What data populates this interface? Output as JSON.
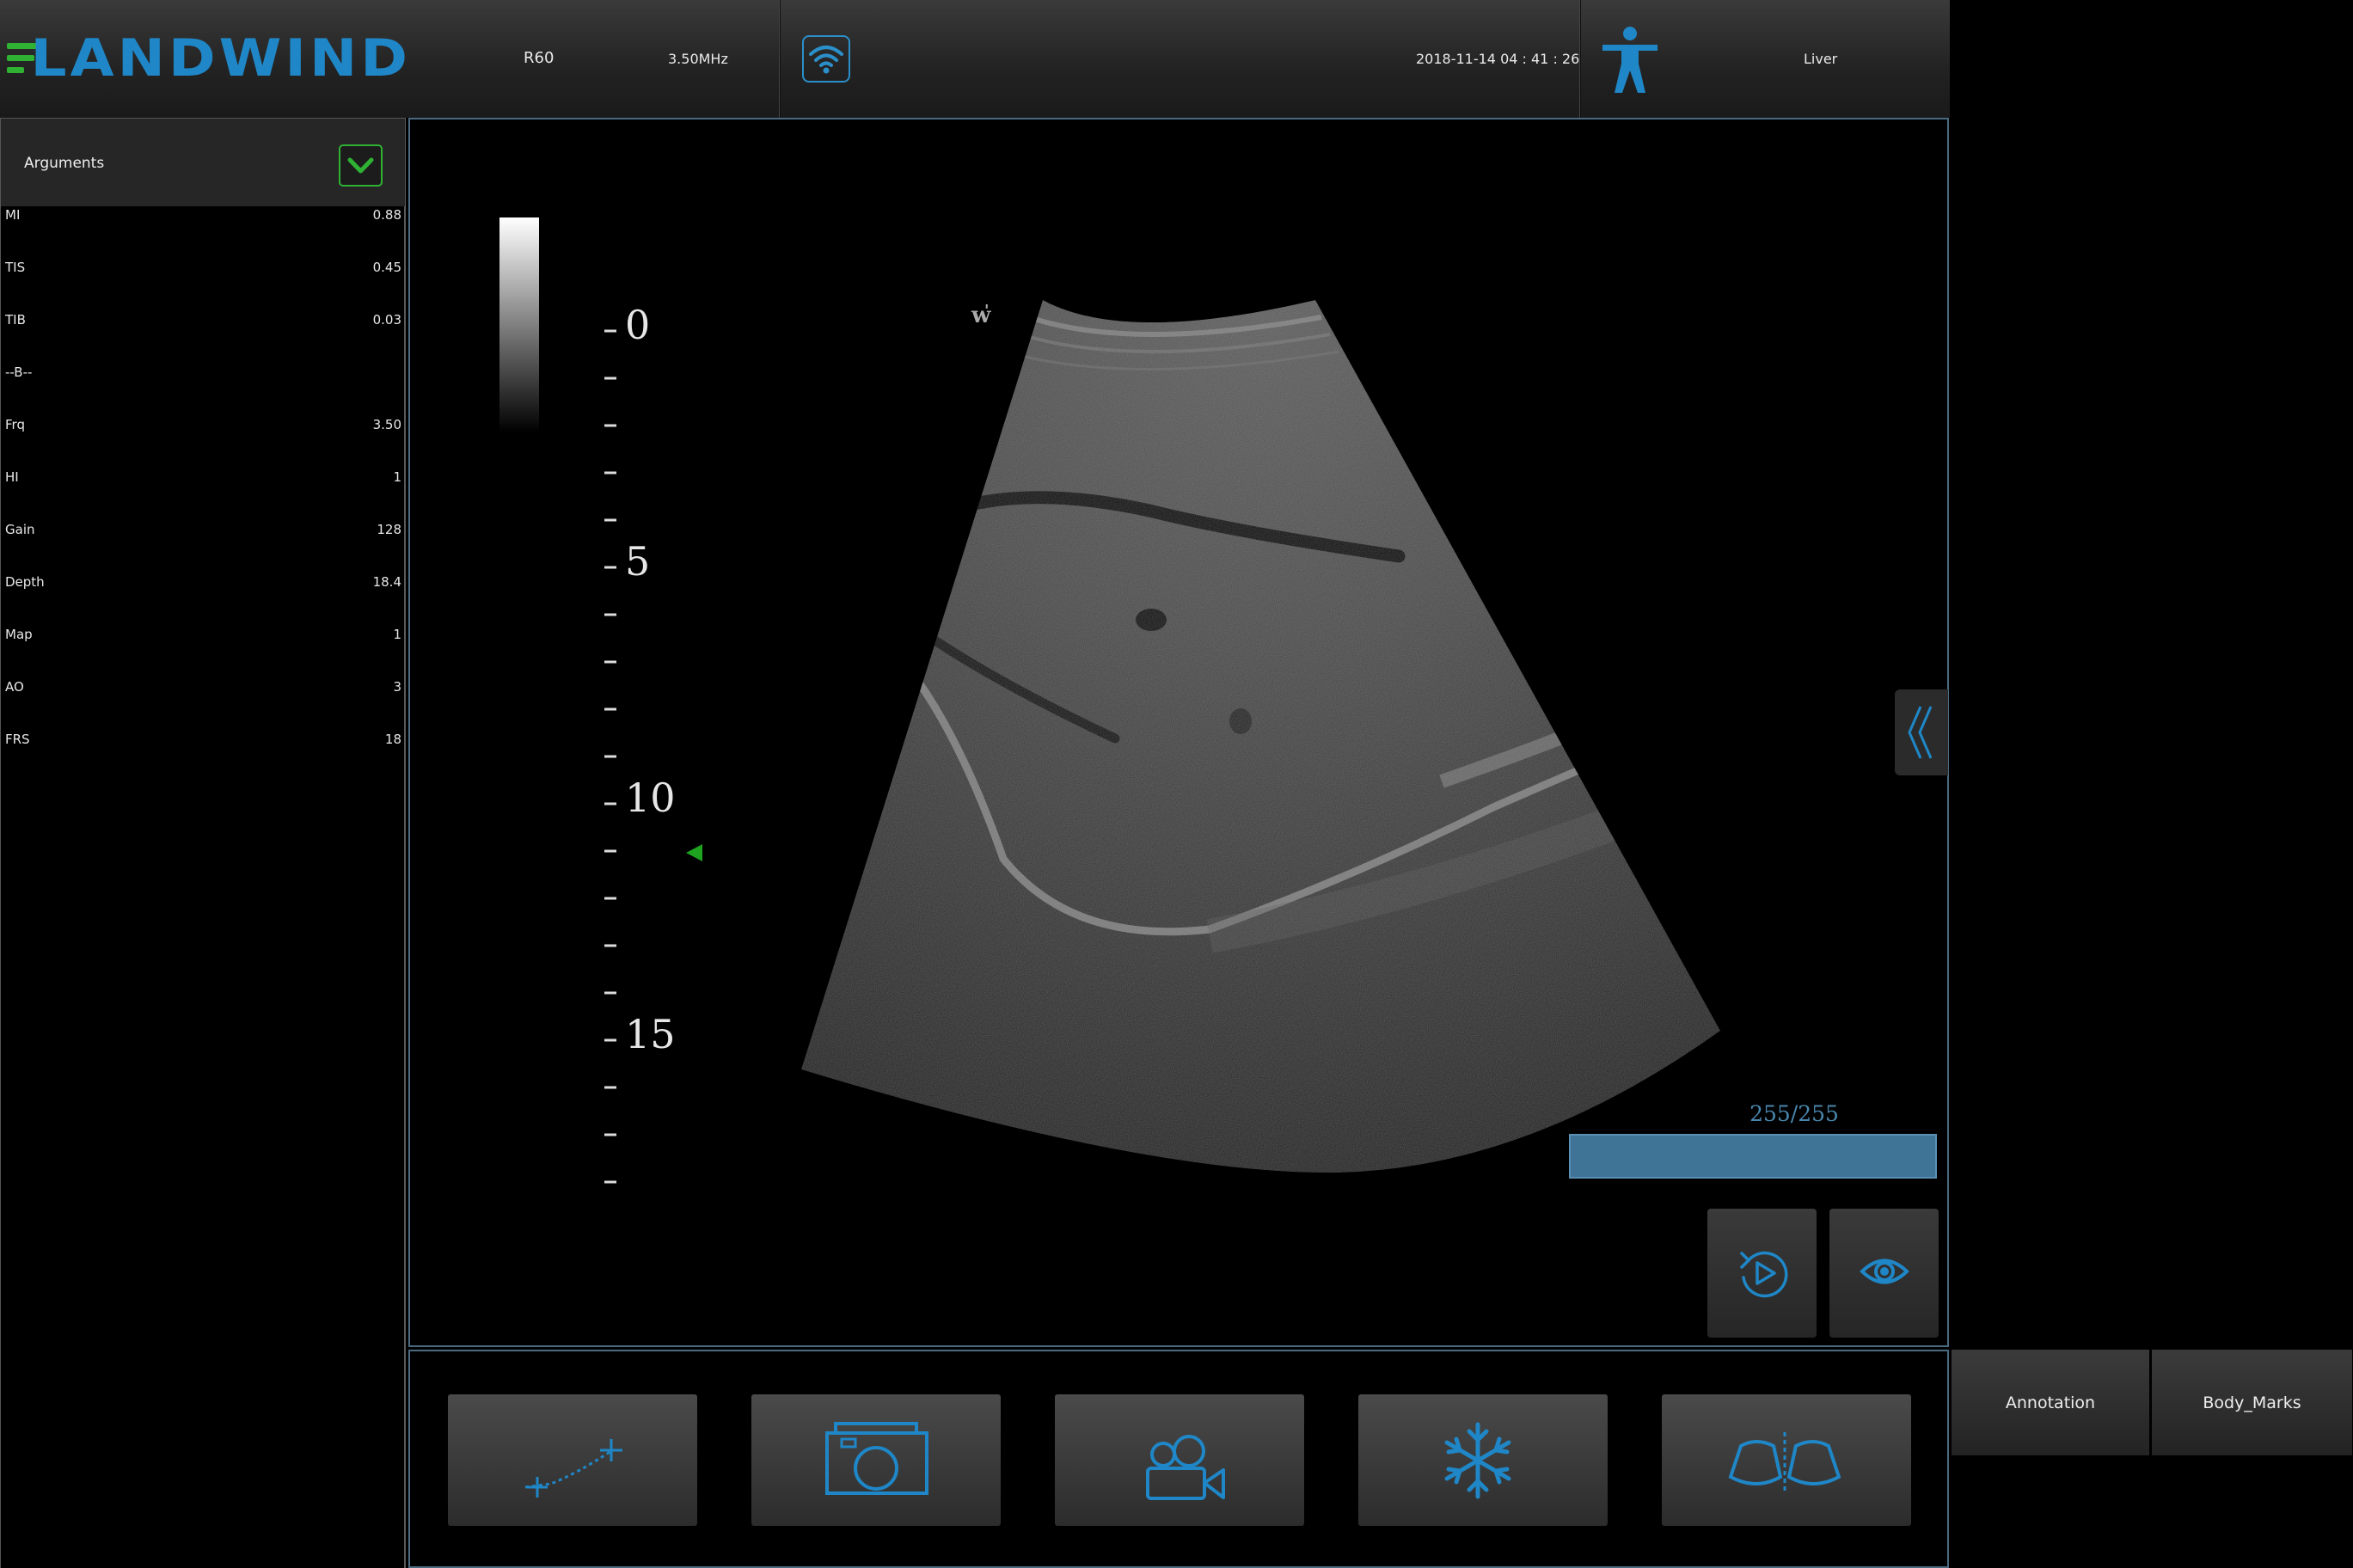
{
  "header": {
    "brand": "LANDWIND",
    "probe": "R60",
    "frequency": "3.50MHz",
    "datetime": "2018-11-14  04 : 41 : 26",
    "preset": "Liver",
    "accent_color": "#1f87c7",
    "brand_green": "#2fb233"
  },
  "arguments": {
    "title": "Arguments",
    "rows": [
      {
        "key": "MI",
        "value": "0.88"
      },
      {
        "key": "TIS",
        "value": "0.45"
      },
      {
        "key": "TIB",
        "value": "0.03"
      },
      {
        "key": "--B--",
        "value": ""
      },
      {
        "key": "Frq",
        "value": "3.50"
      },
      {
        "key": "HI",
        "value": "1"
      },
      {
        "key": "Gain",
        "value": "128"
      },
      {
        "key": "Depth",
        "value": "18.4"
      },
      {
        "key": "Map",
        "value": "1"
      },
      {
        "key": "AO",
        "value": "3"
      },
      {
        "key": "FRS",
        "value": "18"
      }
    ]
  },
  "image": {
    "depth_labels": [
      "0",
      "5",
      "10",
      "15"
    ],
    "cine_counter": "255/255"
  },
  "toolbar": {
    "icons": [
      "measure-icon",
      "camera-icon",
      "video-camera-icon",
      "freeze-icon",
      "dual-view-icon"
    ]
  },
  "side_tabs": {
    "annotation": "Annotation",
    "body_marks": "Body_Marks"
  }
}
